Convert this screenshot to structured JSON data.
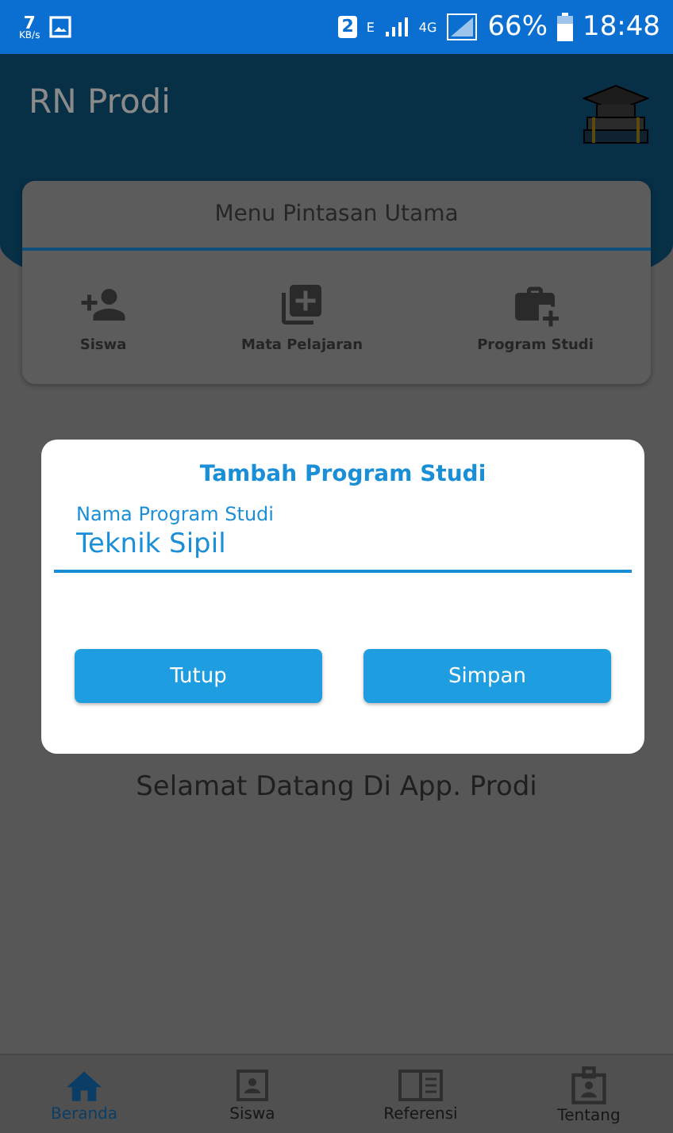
{
  "status_bar": {
    "speed": "7",
    "speed_unit": "KB/s",
    "sim": "2",
    "network": "E",
    "data_type": "4G",
    "battery": "66%",
    "time": "18:48"
  },
  "app_bar": {
    "title": "RN Prodi"
  },
  "shortcut_menu": {
    "title": "Menu Pintasan Utama",
    "items": [
      {
        "label": "Siswa",
        "kind": "person-add"
      },
      {
        "label": "Mata Pelajaran",
        "kind": "library-add"
      },
      {
        "label": "Program Studi",
        "kind": "case-add"
      }
    ]
  },
  "welcome": "Selamat Datang Di App. Prodi",
  "dialog": {
    "title": "Tambah Program Studi",
    "field": {
      "label": "Nama Program Studi",
      "value": "Teknik Sipil"
    },
    "buttons": [
      "Tutup",
      "Simpan"
    ]
  },
  "bottom_nav": [
    {
      "label": "Beranda",
      "kind": "home",
      "selected": true
    },
    {
      "label": "Siswa",
      "kind": "portrait",
      "selected": false
    },
    {
      "label": "Referensi",
      "kind": "book",
      "selected": false
    },
    {
      "label": "Tentang",
      "kind": "badge",
      "selected": false
    }
  ]
}
